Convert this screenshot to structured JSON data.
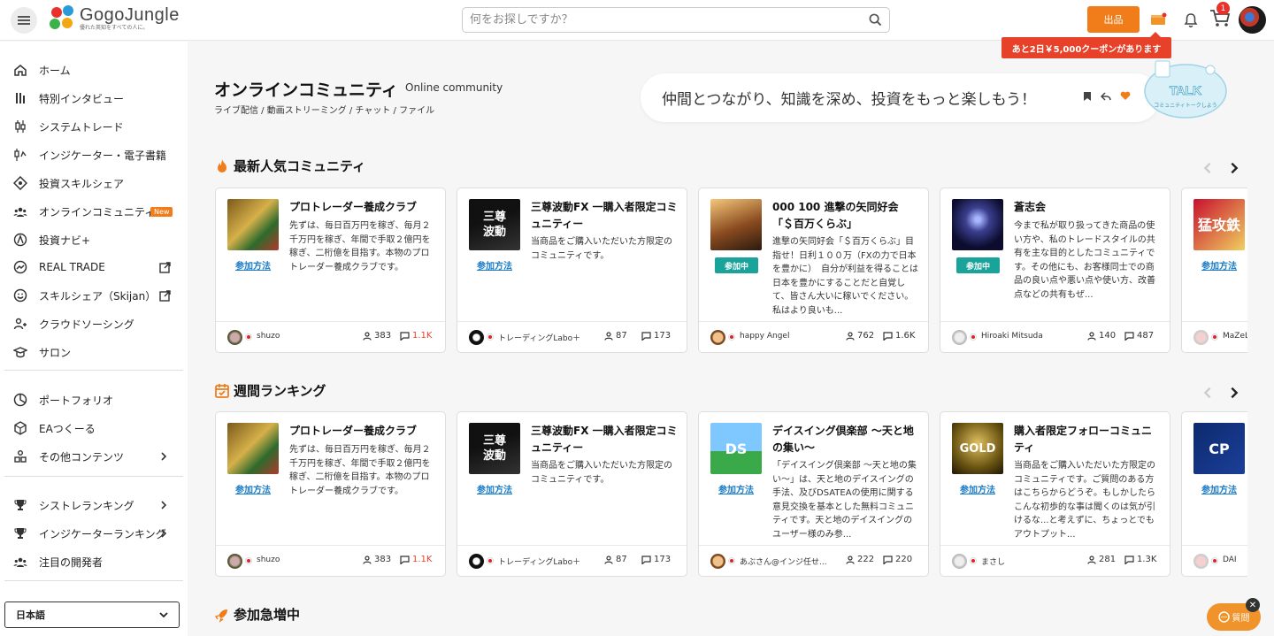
{
  "header": {
    "logo_name": "GogoJungle",
    "logo_tagline": "優れた英知をすべての人に。",
    "search_placeholder": "何をお探しですか？",
    "sell_label": "出品",
    "cart_count": "1",
    "coupon_text": "あと2日￥5,000クーポンがあります"
  },
  "sidebar": {
    "items": [
      {
        "label": "ホーム",
        "icon": "home-icon"
      },
      {
        "label": "特別インタビュー",
        "icon": "interview-icon"
      },
      {
        "label": "システムトレード",
        "icon": "candlestick-icon"
      },
      {
        "label": "インジケーター・電子書籍",
        "icon": "indicator-icon"
      },
      {
        "label": "投資スキルシェア",
        "icon": "skill-share-icon"
      },
      {
        "label": "オンラインコミュニティ",
        "icon": "community-icon",
        "badge": "New"
      },
      {
        "label": "投資ナビ+",
        "icon": "navi-icon"
      },
      {
        "label": "REAL TRADE",
        "icon": "real-trade-icon"
      },
      {
        "label": "スキルシェア（Skijan）",
        "icon": "skijan-icon"
      },
      {
        "label": "クラウドソーシング",
        "icon": "crowdsourcing-icon"
      },
      {
        "label": "サロン",
        "icon": "salon-icon"
      },
      {
        "label": "ポートフォリオ",
        "icon": "portfolio-icon"
      },
      {
        "label": "EAつくーる",
        "icon": "ea-tool-icon"
      },
      {
        "label": "その他コンテンツ",
        "icon": "other-contents-icon"
      },
      {
        "label": "シストレランキング",
        "icon": "trophy-icon"
      },
      {
        "label": "インジケーターランキング",
        "icon": "trophy-icon"
      },
      {
        "label": "注目の開発者",
        "icon": "developers-icon"
      }
    ],
    "language": "日本語"
  },
  "page": {
    "title": "オンラインコミュニティ",
    "title_en": "Online community",
    "tags": "ライブ配信 / 動画ストリーミング / チャット / ファイル",
    "talk_text": "仲間とつながり、知識を深め、投資をもっと楽しもう！",
    "talk_bubble_title": "TALK",
    "talk_bubble_sub": "コミュニティトークしよう"
  },
  "sections": [
    {
      "title": "最新人気コミュニティ",
      "cards": [
        {
          "title": "プロトレーダー養成クラブ",
          "desc": "先ずは、毎日百万円を稼ぎ、毎月２千万円を稼ぎ、年間で手取２億円を稼ぎ、二桁億を目指す。本物のプロトレーダー養成クラブです。",
          "action": "参加方法",
          "joined": false,
          "user": "shuzo",
          "members": "383",
          "posts": "1.1K",
          "hot": true
        },
        {
          "title": "三尊波動FX 一購入者限定コミュニティー",
          "desc": "当商品をご購入いただいた方限定のコミュニティです。",
          "action": "参加方法",
          "joined": false,
          "user": "トレーディングLabo＋",
          "members": "87",
          "posts": "173",
          "hot": false
        },
        {
          "title": "000 100 進撃の矢同好会「＄百万くらぶ」",
          "desc": "進撃の矢同好会「＄百万くらぶ」目指せ！日利１００万（FXの力で日本を豊かに）　自分が利益を得ることは日本を豊かにすることだと自覚して、皆さん大いに稼いでください。私はより良いも...",
          "action": "参加中",
          "joined": true,
          "user": "happy Angel",
          "members": "762",
          "posts": "1.6K",
          "hot": false
        },
        {
          "title": "蒼志会",
          "desc": "今まで私が取り扱ってきた商品の使い方や、私のトレードスタイルの共有を主な目的としたコミュニティです。その他にも、お客様同士での商品の良い点や悪い点や使い方、改善点などの共有もぜ...",
          "action": "参加中",
          "joined": true,
          "user": "Hiroaki Mitsuda",
          "members": "140",
          "posts": "487",
          "hot": false
        },
        {
          "title": "",
          "desc": "",
          "action": "参加方法",
          "joined": false,
          "user": "MaZeL",
          "members": "",
          "posts": "",
          "hot": false
        }
      ]
    },
    {
      "title": "週間ランキング",
      "cards": [
        {
          "title": "プロトレーダー養成クラブ",
          "desc": "先ずは、毎日百万円を稼ぎ、毎月２千万円を稼ぎ、年間で手取２億円を稼ぎ、二桁億を目指す。本物のプロトレーダー養成クラブです。",
          "action": "参加方法",
          "joined": false,
          "user": "shuzo",
          "members": "383",
          "posts": "1.1K",
          "hot": true
        },
        {
          "title": "三尊波動FX 一購入者限定コミュニティー",
          "desc": "当商品をご購入いただいた方限定のコミュニティです。",
          "action": "参加方法",
          "joined": false,
          "user": "トレーディングLabo＋",
          "members": "87",
          "posts": "173",
          "hot": false
        },
        {
          "title": "デイスイング倶楽部 ～天と地の集い～",
          "desc": "「デイスイング倶楽部 ～天と地の集い～」は、天と地のデイスイングの手法、及びDSATEAの使用に関する意見交換を基本とした無料コミュニティです。天と地のデイスイングのユーザー様のみ参...",
          "action": "参加方法",
          "joined": false,
          "user": "あぶさん@インジ任せ...",
          "members": "222",
          "posts": "220",
          "hot": false
        },
        {
          "title": "購入者限定フォローコミュニティ",
          "desc": "当商品をご購入いただいた方限定のコミュニティです。ご質問のある方はこちらからどうぞ。もしかしたらこんな初歩的な事は聞くのは気が引けるな...と考えずに、ちょっとでもアウトプット...",
          "action": "参加方法",
          "joined": false,
          "user": "まさし",
          "members": "281",
          "posts": "1.3K",
          "hot": false
        },
        {
          "title": "",
          "desc": "",
          "action": "参加方法",
          "joined": false,
          "user": "DAI",
          "members": "",
          "posts": "",
          "hot": false
        }
      ]
    },
    {
      "title": "参加急増中",
      "cards": []
    }
  ],
  "chat": {
    "label": "質問",
    "close": "✕"
  },
  "colors": {
    "accent": "#f07d1a",
    "hot": "#e8412a",
    "joined": "#1aa39a",
    "link": "#1a7cc7"
  }
}
